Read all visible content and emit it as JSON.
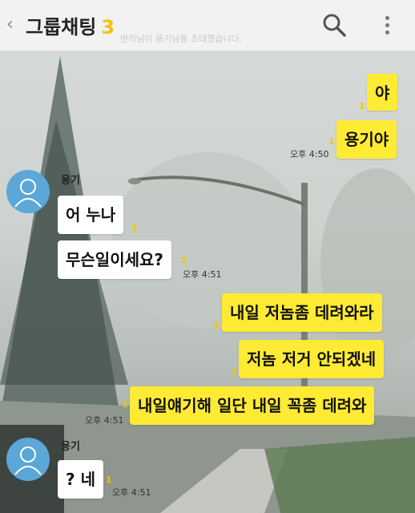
{
  "header": {
    "title": "그룹채팅",
    "member_count": "3",
    "notice": "변하님이 용기님을 초대했습니다."
  },
  "messages": [
    {
      "text": "야",
      "unread": "1"
    },
    {
      "text": "용기야",
      "unread": "1",
      "time": "오후 4:50"
    },
    {
      "sender": "용기",
      "text": "어 누나",
      "unread": "1"
    },
    {
      "text": "무슨일이세요?",
      "unread": "1",
      "time": "오후 4:51"
    },
    {
      "text": "내일 저놈좀 데려와라",
      "unread": "1"
    },
    {
      "text": "저놈 저거 안되겠네",
      "unread": "1"
    },
    {
      "text": "내일얘기해 일단 내일 꼭좀 데려와",
      "unread": "1",
      "time": "오후 4:51"
    },
    {
      "sender": "용기",
      "text": "? 네",
      "unread": "1",
      "time": "오후 4:51"
    }
  ],
  "colors": {
    "my_bubble": "#ffeb33",
    "their_bubble": "#ffffff",
    "accent": "#f3c400"
  }
}
